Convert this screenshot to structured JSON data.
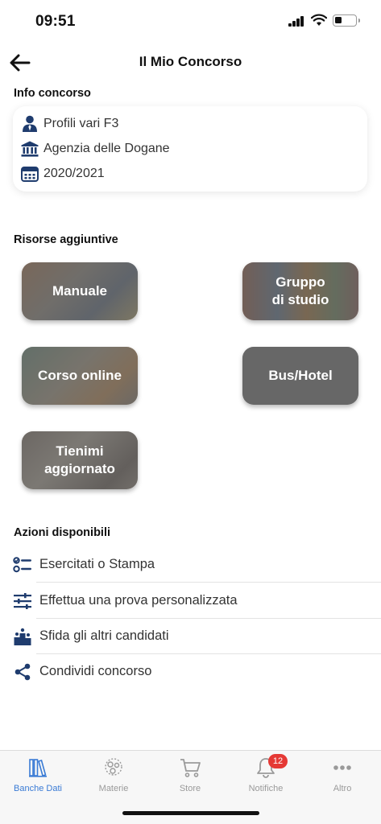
{
  "status": {
    "time": "09:51"
  },
  "header": {
    "title": "Il Mio Concorso",
    "back_icon": "arrow-left-icon"
  },
  "info": {
    "section_label": "Info concorso",
    "profile": "Profili vari F3",
    "agency": "Agenzia delle Dogane",
    "year": "2020/2021",
    "icon_color": "#1f3c6e"
  },
  "resources": {
    "section_label": "Risorse aggiuntive",
    "tiles": [
      {
        "label": "Manuale"
      },
      {
        "label": "Gruppo\ndi studio"
      },
      {
        "label": "Corso online"
      },
      {
        "label": "Bus/Hotel"
      },
      {
        "label": "Tienimi\naggiornato"
      }
    ]
  },
  "actions": {
    "section_label": "Azioni disponibili",
    "items": [
      {
        "label": "Esercitati o Stampa",
        "icon": "checklist-icon"
      },
      {
        "label": "Effettua una prova personalizzata",
        "icon": "sliders-icon"
      },
      {
        "label": "Sfida gli altri candidati",
        "icon": "podium-icon"
      },
      {
        "label": "Condividi concorso",
        "icon": "share-icon"
      }
    ]
  },
  "tabbar": {
    "accent": "#3a7bd5",
    "tabs": [
      {
        "label": "Banche Dati",
        "active": true
      },
      {
        "label": "Materie",
        "active": false
      },
      {
        "label": "Store",
        "active": false
      },
      {
        "label": "Notifiche",
        "active": false,
        "badge": "12"
      },
      {
        "label": "Altro",
        "active": false
      }
    ]
  }
}
